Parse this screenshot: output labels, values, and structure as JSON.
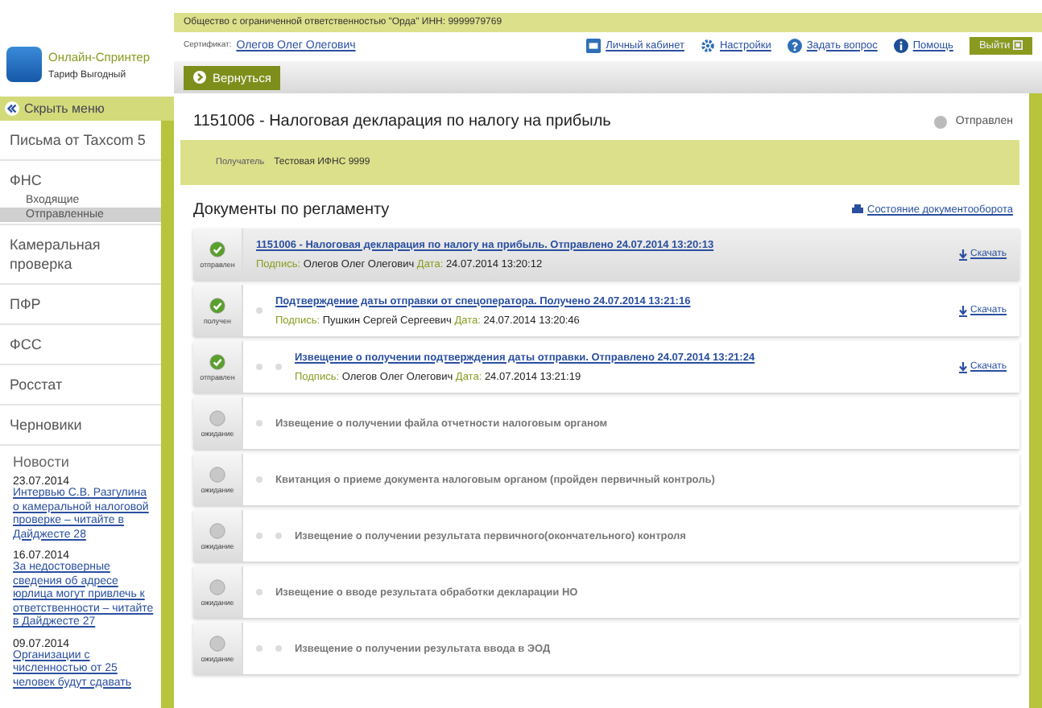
{
  "app": {
    "name": "Онлайн-Спринтер",
    "tariff": "Тариф Выгодный"
  },
  "org_bar": "Общество с ограниченной ответственностью \"Орда\" ИНН: 9999979769",
  "certificate": {
    "label": "Сертификат:",
    "name": "Олегов Олег Олегович"
  },
  "top_links": [
    {
      "label": "Личный кабинет"
    },
    {
      "label": "Настройки"
    },
    {
      "label": "Задать вопрос"
    },
    {
      "label": "Помощь"
    }
  ],
  "logout": "Выйти",
  "back_button": "Вернуться",
  "sidebar": {
    "hide_menu": "Скрыть меню",
    "items": [
      {
        "label": "Письма от Taxcom 5",
        "selected": false
      },
      {
        "label": "ФНС",
        "selected": false,
        "children": [
          {
            "label": "Входящие",
            "selected": false
          },
          {
            "label": "Отправленные",
            "selected": true
          }
        ]
      },
      {
        "label": "Камеральная проверка",
        "selected": false
      },
      {
        "label": "ПФР",
        "selected": false
      },
      {
        "label": "ФСС",
        "selected": false
      },
      {
        "label": "Росстат",
        "selected": false
      },
      {
        "label": "Черновики",
        "selected": false
      }
    ]
  },
  "news": {
    "title": "Новости",
    "items": [
      {
        "date": "23.07.2014",
        "text": "Интервью С.В. Разгулина о камеральной налоговой проверке – читайте в Дайджесте 28"
      },
      {
        "date": "16.07.2014",
        "text": "За недостоверные сведения об адресе юрлица могут привлечь к ответственности – читайте в Дайджесте 27"
      },
      {
        "date": "09.07.2014",
        "text": "Организации с численностью от 25 человек будут сдавать"
      }
    ]
  },
  "document": {
    "title": "1151006 - Налоговая декларация по налогу на прибыль",
    "status": "Отправлен",
    "recipient_label": "Получатель",
    "recipient": "Тестовая ИФНС 9999"
  },
  "regulations": {
    "title": "Документы по регламенту",
    "state_link": "Состояние документооборота",
    "documents": [
      {
        "kind": "sent",
        "status": "отправлен",
        "selected": true,
        "title": "1151006 - Налоговая декларация по налогу на прибыль. Отправлено 24.07.2014 13:20:13",
        "signature_label": "Подпись:",
        "signer": "Олегов Олег Олегович",
        "date_label": "Дата:",
        "date": "24.07.2014 13:20:12",
        "download": "Скачать",
        "children": [
          {
            "kind": "received",
            "status": "получен",
            "selected": false,
            "title": "Подтверждение даты отправки от спецоператора. Получено 24.07.2014 13:21:16",
            "signature_label": "Подпись:",
            "signer": "Пушкин Сергей Сергеевич",
            "date_label": "Дата:",
            "date": "24.07.2014 13:20:46",
            "download": "Скачать",
            "children": [
              {
                "kind": "sent",
                "status": "отправлен",
                "selected": false,
                "title": "Извещение о получении подтверждения даты отправки. Отправлено 24.07.2014 13:21:24",
                "signature_label": "Подпись:",
                "signer": "Олегов Олег Олегович",
                "date_label": "Дата:",
                "date": "24.07.2014 13:21:19",
                "download": "Скачать"
              }
            ]
          },
          {
            "kind": "waiting",
            "status": "ожидание",
            "selected": false,
            "title": "Извещение о получении файла отчетности налоговым органом"
          },
          {
            "kind": "waiting",
            "status": "ожидание",
            "selected": false,
            "title": "Квитанция о приеме документа налоговым органом (пройден первичный контроль)",
            "children": [
              {
                "kind": "waiting",
                "status": "ожидание",
                "selected": false,
                "title": "Извещение о получении результата первичного(окончательного) контроля"
              }
            ]
          },
          {
            "kind": "waiting",
            "status": "ожидание",
            "selected": false,
            "title": "Извещение о вводе результата обработки декларации НО",
            "children": [
              {
                "kind": "waiting",
                "status": "ожидание",
                "selected": false,
                "title": "Извещение о получении результата ввода в ЭОД"
              }
            ]
          }
        ]
      }
    ]
  }
}
